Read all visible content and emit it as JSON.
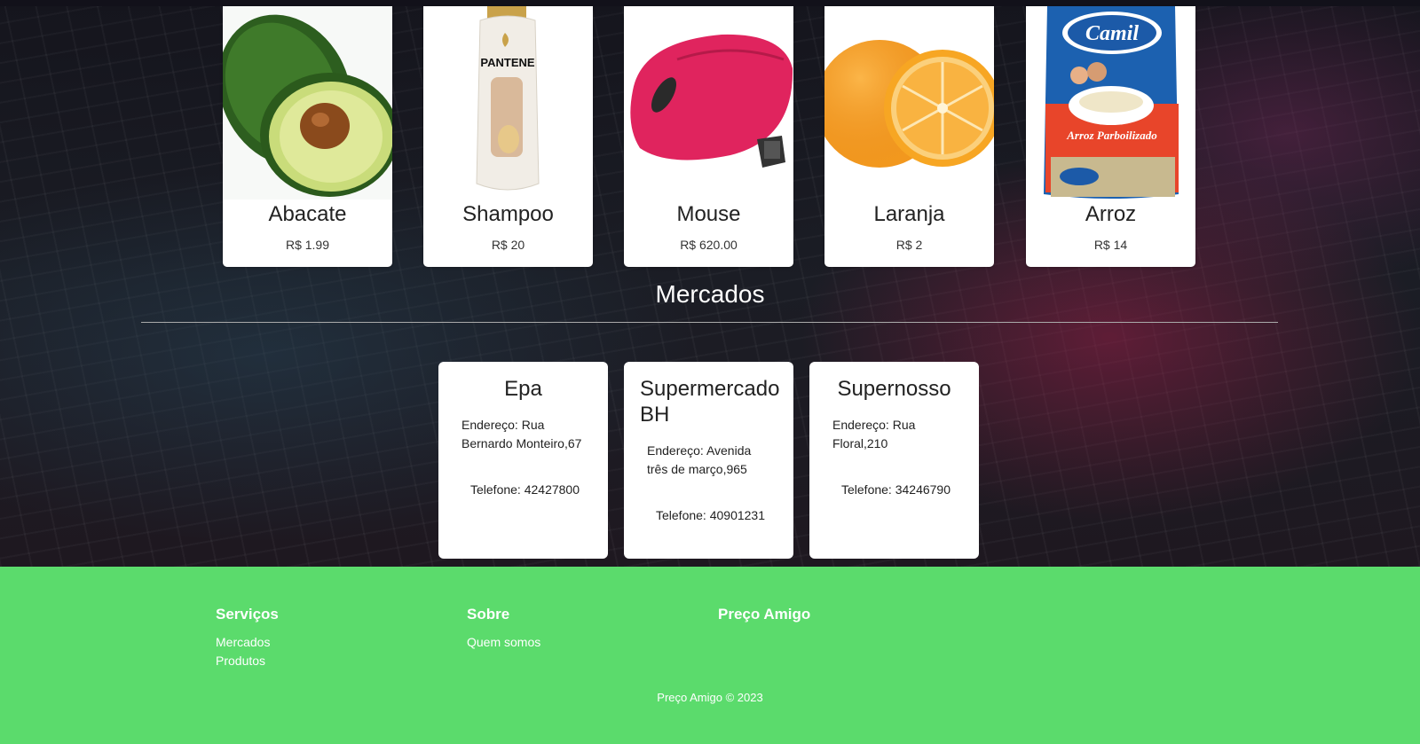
{
  "products": [
    {
      "name": "Abacate",
      "price": "R$ 1.99",
      "image_icon": "avocado-icon"
    },
    {
      "name": "Shampoo",
      "price": "R$ 20",
      "image_icon": "shampoo-bottle-icon",
      "brand_text": "PANTENE"
    },
    {
      "name": "Mouse",
      "price": "R$ 620.00",
      "image_icon": "mouse-icon"
    },
    {
      "name": "Laranja",
      "price": "R$ 2",
      "image_icon": "orange-icon"
    },
    {
      "name": "Arroz",
      "price": "R$ 14",
      "image_icon": "rice-bag-icon",
      "brand_text": "Camil",
      "package_text": "Arroz Parboilizado"
    }
  ],
  "markets_section": {
    "title": "Mercados"
  },
  "markets": [
    {
      "name": "Epa",
      "address": "Endereço: Rua Bernardo Monteiro,67",
      "phone": "Telefone: 42427800"
    },
    {
      "name": "Supermercado BH",
      "address": "Endereço: Avenida três de março,965",
      "phone": "Telefone: 40901231"
    },
    {
      "name": "Supernosso",
      "address": "Endereço: Rua Floral,210",
      "phone": "Telefone: 34246790"
    }
  ],
  "footer": {
    "services": {
      "title": "Serviços",
      "links": [
        "Mercados",
        "Produtos"
      ]
    },
    "about": {
      "title": "Sobre",
      "links": [
        "Quem somos"
      ]
    },
    "brand": {
      "title": "Preço Amigo"
    },
    "copyright": "Preço Amigo © 2023"
  },
  "colors": {
    "footer_bg": "#5bdb6c",
    "card_bg": "#ffffff",
    "mouse": "#e0245e",
    "orange": "#f7931e",
    "avocado": "#3f7a2a"
  }
}
